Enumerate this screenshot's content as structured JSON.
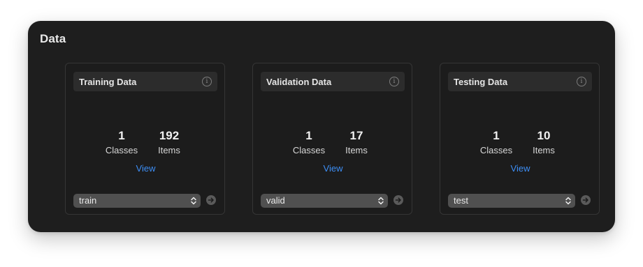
{
  "panel": {
    "title": "Data"
  },
  "cards": [
    {
      "title": "Training Data",
      "classes_value": "1",
      "classes_label": "Classes",
      "items_value": "192",
      "items_label": "Items",
      "view_label": "View",
      "select_value": "train"
    },
    {
      "title": "Validation Data",
      "classes_value": "1",
      "classes_label": "Classes",
      "items_value": "17",
      "items_label": "Items",
      "view_label": "View",
      "select_value": "valid"
    },
    {
      "title": "Testing Data",
      "classes_value": "1",
      "classes_label": "Classes",
      "items_value": "10",
      "items_label": "Items",
      "view_label": "View",
      "select_value": "test"
    }
  ],
  "icons": {
    "info": "info-circle-icon",
    "select": "up-down-chevron-icon",
    "go": "arrow-right-circle-icon"
  },
  "colors": {
    "panel_background": "#1e1e1e",
    "link": "#3d8ef5"
  }
}
